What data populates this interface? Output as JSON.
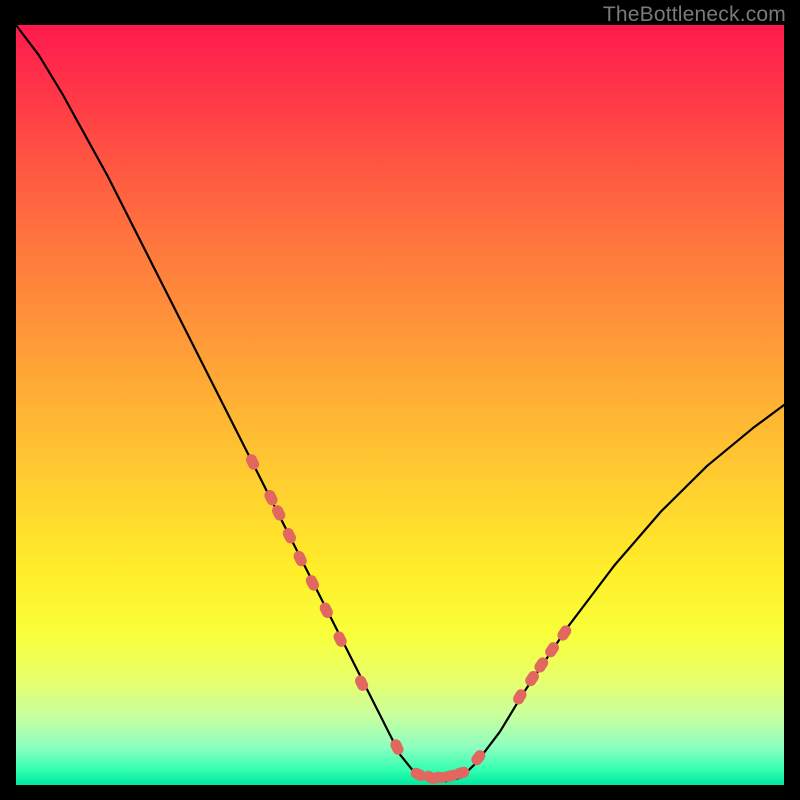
{
  "watermark": {
    "text": "TheBottleneck.com"
  },
  "colors": {
    "frame": "#000000",
    "curve": "#000000",
    "marker": "#e2675f"
  },
  "chart_data": {
    "type": "line",
    "title": "",
    "xlabel": "",
    "ylabel": "",
    "xlim": [
      0,
      100
    ],
    "ylim": [
      0,
      100
    ],
    "grid": false,
    "legend": false,
    "series": [
      {
        "name": "bottleneck-curve",
        "x": [
          0,
          3,
          6,
          9,
          12,
          15,
          18,
          21,
          24,
          27,
          30,
          33,
          36,
          39,
          42,
          45,
          48,
          50,
          52,
          54,
          56,
          58,
          60,
          63,
          66,
          69,
          72,
          75,
          78,
          81,
          84,
          87,
          90,
          93,
          96,
          100
        ],
        "y": [
          100,
          96,
          91,
          85.5,
          80,
          74,
          68,
          62,
          56,
          50,
          44,
          38,
          32,
          26,
          20,
          14,
          8,
          4,
          1.5,
          0.5,
          0.5,
          1,
          3,
          7,
          12,
          16.5,
          21,
          25,
          29,
          32.5,
          36,
          39,
          42,
          44.5,
          47,
          50
        ]
      }
    ],
    "markers": [
      {
        "name": "highlight-dots",
        "x": [
          30.8,
          33.2,
          34.2,
          35.6,
          37.0,
          38.6,
          40.4,
          42.2,
          45.0,
          49.6,
          52.4,
          54.0,
          55.2,
          56.6,
          58.0,
          60.2,
          65.6,
          67.2,
          68.4,
          69.8,
          71.4
        ],
        "y": [
          42.5,
          37.8,
          35.8,
          32.8,
          29.8,
          26.6,
          23.0,
          19.2,
          13.4,
          5.0,
          1.4,
          1.0,
          1.0,
          1.2,
          1.6,
          3.6,
          11.6,
          14.0,
          15.8,
          17.8,
          20.0
        ]
      }
    ]
  }
}
